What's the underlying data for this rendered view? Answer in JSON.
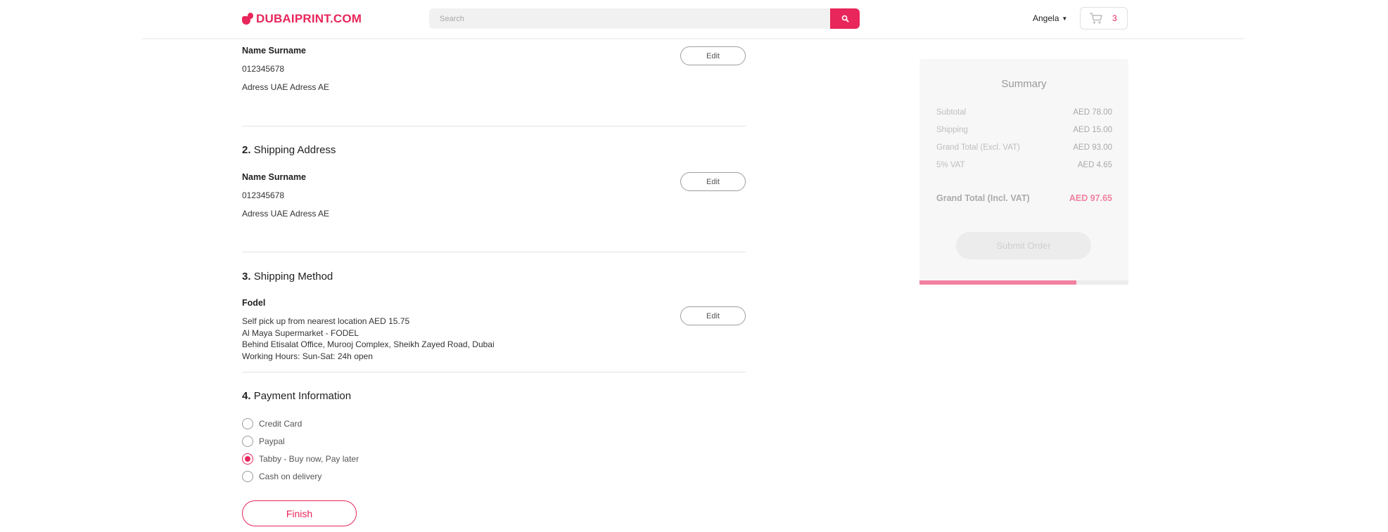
{
  "header": {
    "logo_text": "DUBAIPRINT.COM",
    "search_placeholder": "Search",
    "user_name": "Angela",
    "cart_count": "3"
  },
  "billing": {
    "name": "Name Surname",
    "phone": "012345678",
    "address": "Adress UAE Adress AE",
    "edit_label": "Edit"
  },
  "shipping_address": {
    "number": "2.",
    "title": "Shipping Address",
    "name": "Name Surname",
    "phone": "012345678",
    "address": "Adress UAE Adress AE",
    "edit_label": "Edit"
  },
  "shipping_method": {
    "number": "3.",
    "title": "Shipping Method",
    "carrier": "Fodel",
    "lines": [
      "Self pick up from nearest location AED 15.75",
      "Al Maya Supermarket - FODEL",
      "Behind Etisalat Office, Murooj Complex, Sheikh Zayed Road, Dubai",
      "Working Hours: Sun-Sat: 24h open"
    ],
    "edit_label": "Edit"
  },
  "payment": {
    "number": "4.",
    "title": "Payment Information",
    "options": [
      {
        "label": "Credit Card",
        "selected": false
      },
      {
        "label": "Paypal",
        "selected": false
      },
      {
        "label": "Tabby - Buy now, Pay later",
        "selected": true
      },
      {
        "label": "Cash on delivery",
        "selected": false
      }
    ],
    "finish_label": "Finish"
  },
  "summary": {
    "title": "Summary",
    "rows": [
      {
        "label": "Subtotal",
        "value": "AED 78.00"
      },
      {
        "label": "Shipping",
        "value": "AED 15.00"
      },
      {
        "label": "Grand Total (Excl. VAT)",
        "value": "AED 93.00"
      },
      {
        "label": "5% VAT",
        "value": "AED 4.65"
      }
    ],
    "total_label": "Grand Total (Incl. VAT)",
    "total_value": "AED 97.65",
    "submit_label": "Submit Order",
    "progress_fraction": 0.75
  },
  "colors": {
    "brand": "#e8265b",
    "brand_light": "#f0829f"
  },
  "icons": [
    "search-icon",
    "cart-icon",
    "chevron-down-icon"
  ]
}
